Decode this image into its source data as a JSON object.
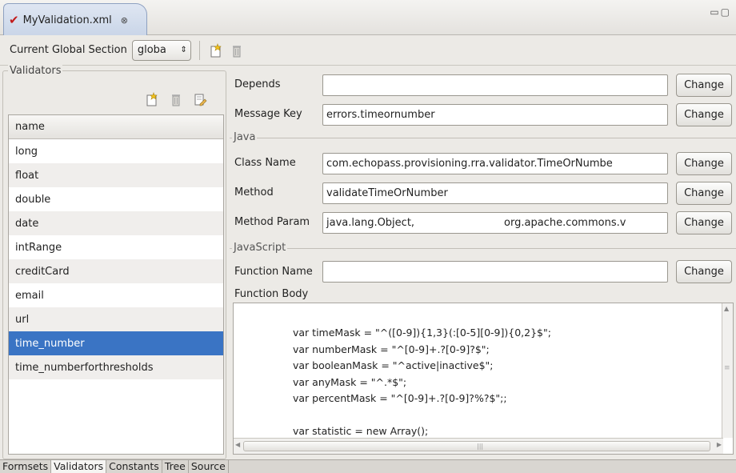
{
  "editor": {
    "tab_title": "MyValidation.xml",
    "close_glyph": "⊗"
  },
  "toolbar": {
    "global_section_label": "Current Global Section",
    "global_section_value": "globa"
  },
  "validators": {
    "group_label": "Validators",
    "column_header": "name",
    "items": [
      "long",
      "float",
      "double",
      "date",
      "intRange",
      "creditCard",
      "email",
      "url",
      "time_number",
      "time_numberforthresholds"
    ],
    "selected": "time_number"
  },
  "general": {
    "depends_label": "Depends",
    "depends_value": "",
    "message_key_label": "Message Key",
    "message_key_value": "errors.timeornumber",
    "change_label": "Change"
  },
  "java": {
    "group_label": "Java",
    "class_name_label": "Class Name",
    "class_name_value": "com.echopass.provisioning.rra.validator.TimeOrNumbe",
    "method_label": "Method",
    "method_value": "validateTimeOrNumber",
    "method_param_label": "Method Param",
    "method_param_value_1": "java.lang.Object,",
    "method_param_value_2": "org.apache.commons.v"
  },
  "javascript": {
    "group_label": "JavaScript",
    "function_name_label": "Function Name",
    "function_name_value": "",
    "function_body_label": "Function Body",
    "body_lines": [
      "var timeMask = \"^([0-9]){1,3}(:[0-5][0-9]){0,2}$\";",
      "var numberMask = \"^[0-9]+.?[0-9]?$\";",
      "var booleanMask = \"^active|inactive$\";",
      "var anyMask = \"^.*$\";",
      "var percentMask = \"^[0-9]+.?[0-9]?%?$\";;",
      "",
      "var statistic = new Array();"
    ],
    "hscroll_grip": "|||"
  },
  "bottom_tabs": [
    "Formsets",
    "Validators",
    "Constants",
    "Tree",
    "Source"
  ],
  "active_bottom_tab": "Validators",
  "colors": {
    "selection": "#3a74c4",
    "error_check": "#c21a1a"
  }
}
